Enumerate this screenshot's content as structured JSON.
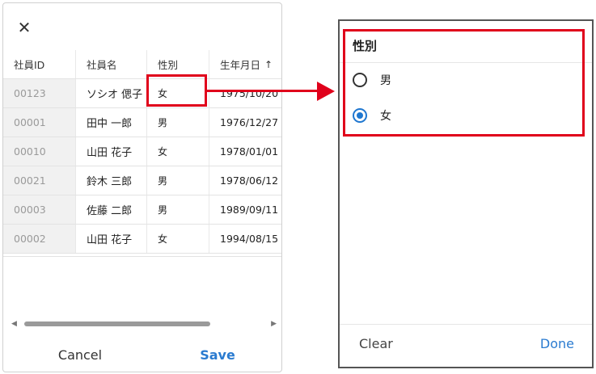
{
  "left": {
    "close_icon": "close-icon",
    "columns": [
      "社員ID",
      "社員名",
      "性別",
      "生年月日"
    ],
    "sort_indicator": "↑",
    "rows": [
      {
        "id": "00123",
        "name": "ソシオ 偲子",
        "gender": "女",
        "birth": "1975/10/20"
      },
      {
        "id": "00001",
        "name": "田中 一郎",
        "gender": "男",
        "birth": "1976/12/27"
      },
      {
        "id": "00010",
        "name": "山田 花子",
        "gender": "女",
        "birth": "1978/01/01"
      },
      {
        "id": "00021",
        "name": "鈴木 三郎",
        "gender": "男",
        "birth": "1978/06/12"
      },
      {
        "id": "00003",
        "name": "佐藤 二郎",
        "gender": "男",
        "birth": "1989/09/11"
      },
      {
        "id": "00002",
        "name": "山田 花子",
        "gender": "女",
        "birth": "1994/08/15"
      }
    ],
    "cancel_label": "Cancel",
    "save_label": "Save",
    "accent_color": "#2a7bd0"
  },
  "right": {
    "title": "性別",
    "options": [
      {
        "label": "男",
        "checked": false
      },
      {
        "label": "女",
        "checked": true
      }
    ],
    "clear_label": "Clear",
    "done_label": "Done"
  },
  "highlight_color": "#e0001b"
}
